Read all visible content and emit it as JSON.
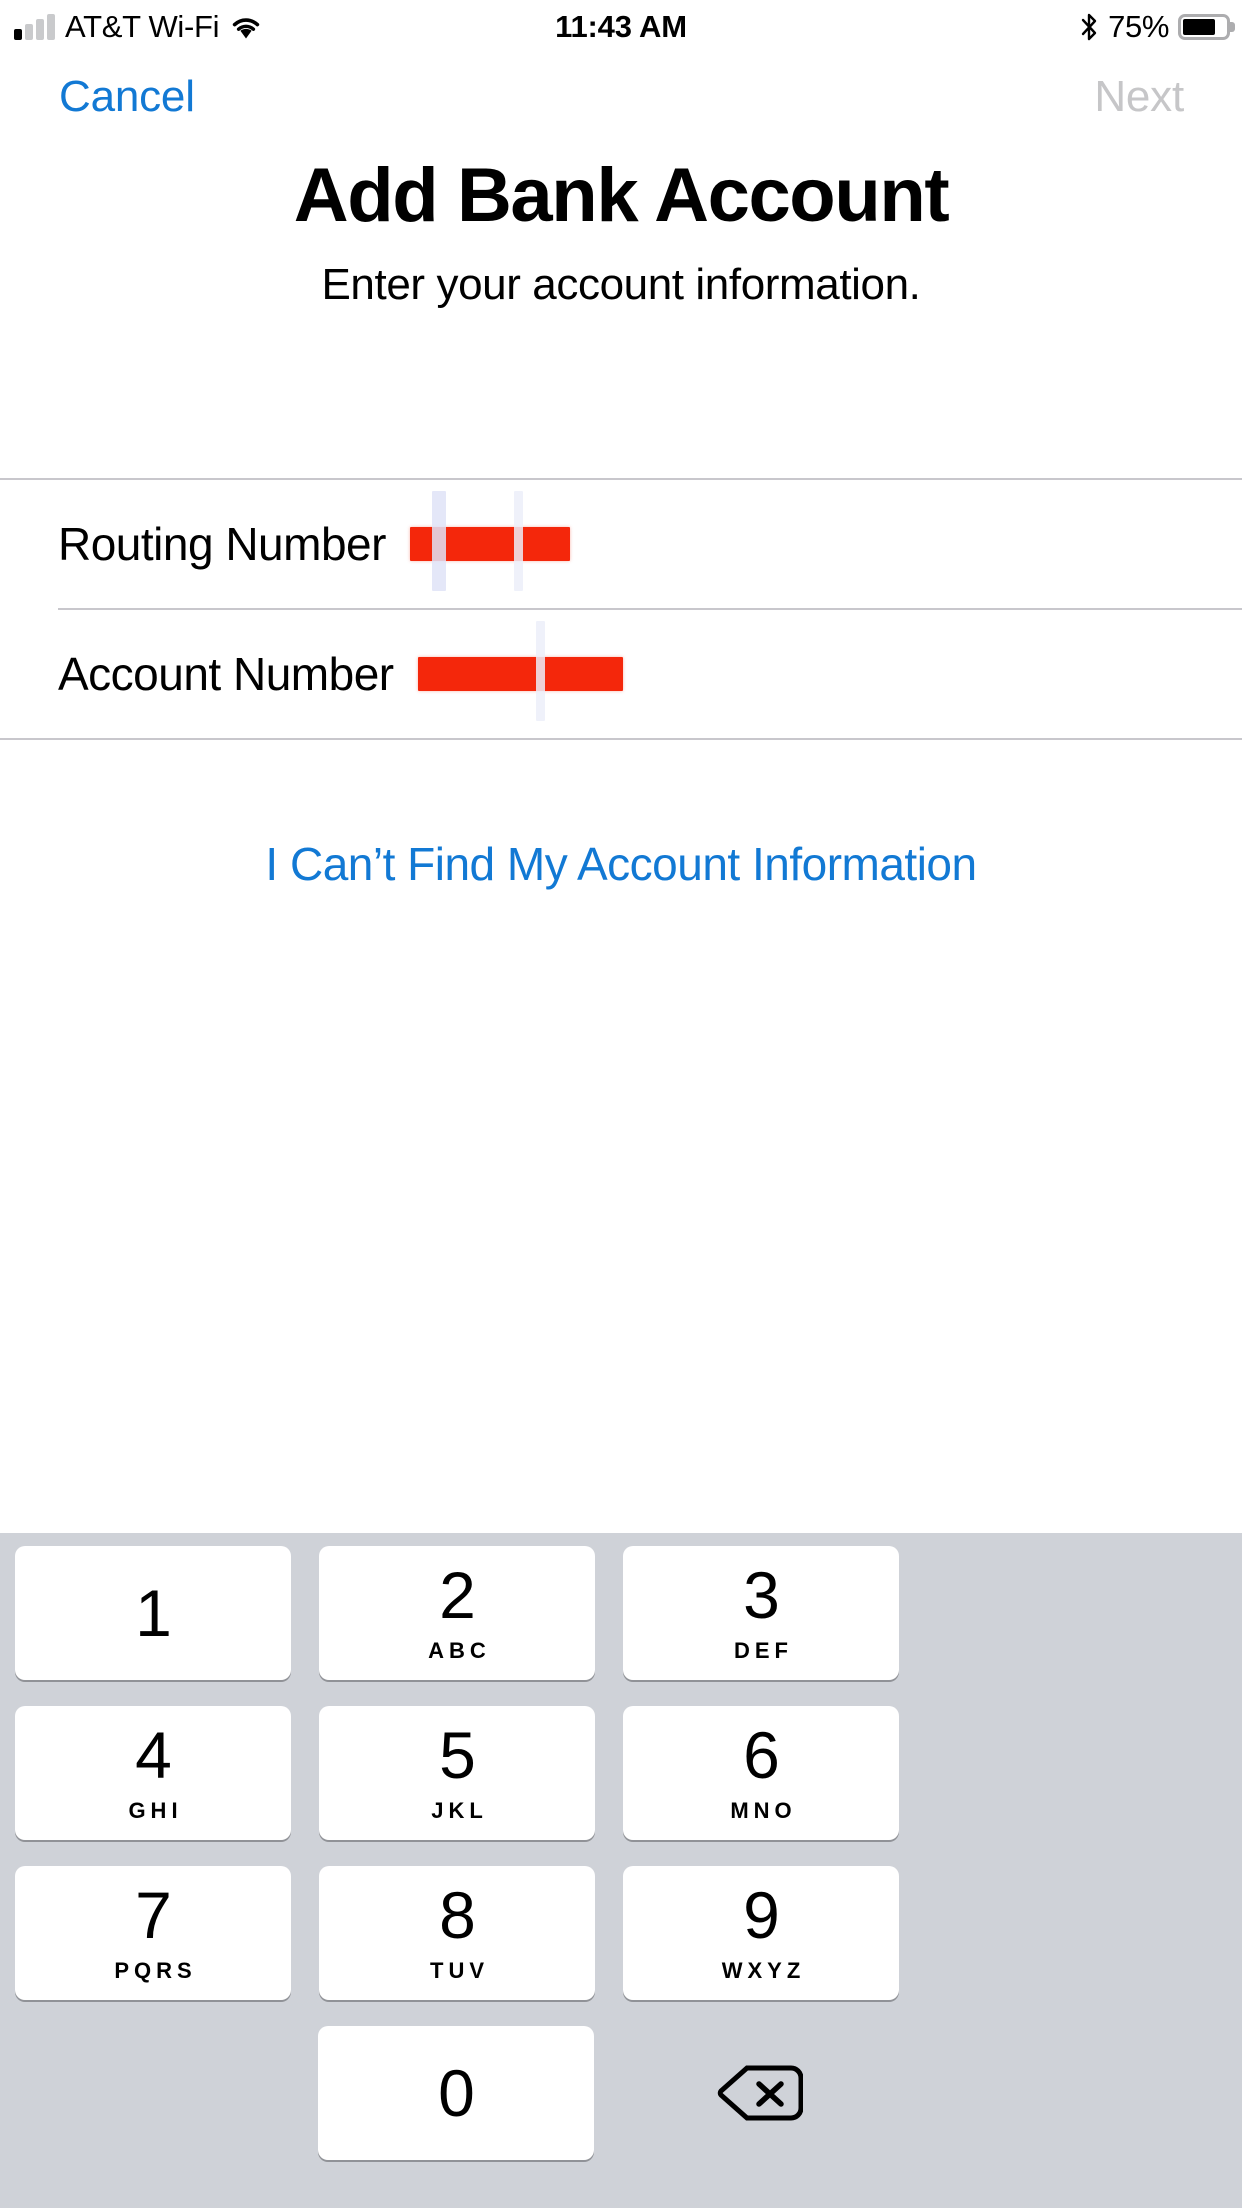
{
  "status_bar": {
    "carrier": "AT&T Wi-Fi",
    "signal_icon": "signal-bars-icon",
    "wifi_icon": "wifi-icon",
    "time": "11:43 AM",
    "bluetooth_icon": "bluetooth-icon",
    "battery_percent": "75%",
    "battery_level": 75,
    "battery_icon": "battery-icon"
  },
  "nav_bar": {
    "cancel_label": "Cancel",
    "next_label": "Next",
    "cancel_color": "#1279d4",
    "next_color": "#c6c6c8"
  },
  "header": {
    "title": "Add Bank Account",
    "subtitle": "Enter your account information."
  },
  "form": {
    "rows": [
      {
        "label": "Routing Number",
        "value": "",
        "redacted": true,
        "redaction_width": 160
      },
      {
        "label": "Account Number",
        "value": "",
        "redacted": true,
        "redaction_width": 205
      }
    ],
    "redaction_color": "#f4270b"
  },
  "help": {
    "link_label": "I Can’t Find My Account Information",
    "link_color": "#1279d4"
  },
  "keyboard": {
    "background_color": "#cfd2d8",
    "key_color": "#ffffff",
    "rows": [
      [
        {
          "digit": "1",
          "letters": ""
        },
        {
          "digit": "2",
          "letters": "ABC"
        },
        {
          "digit": "3",
          "letters": "DEF"
        }
      ],
      [
        {
          "digit": "4",
          "letters": "GHI"
        },
        {
          "digit": "5",
          "letters": "JKL"
        },
        {
          "digit": "6",
          "letters": "MNO"
        }
      ],
      [
        {
          "digit": "7",
          "letters": "PQRS"
        },
        {
          "digit": "8",
          "letters": "TUV"
        },
        {
          "digit": "9",
          "letters": "WXYZ"
        }
      ]
    ],
    "last_row": {
      "digit": "0",
      "letters": "",
      "backspace_icon": "backspace-delete-icon"
    }
  }
}
